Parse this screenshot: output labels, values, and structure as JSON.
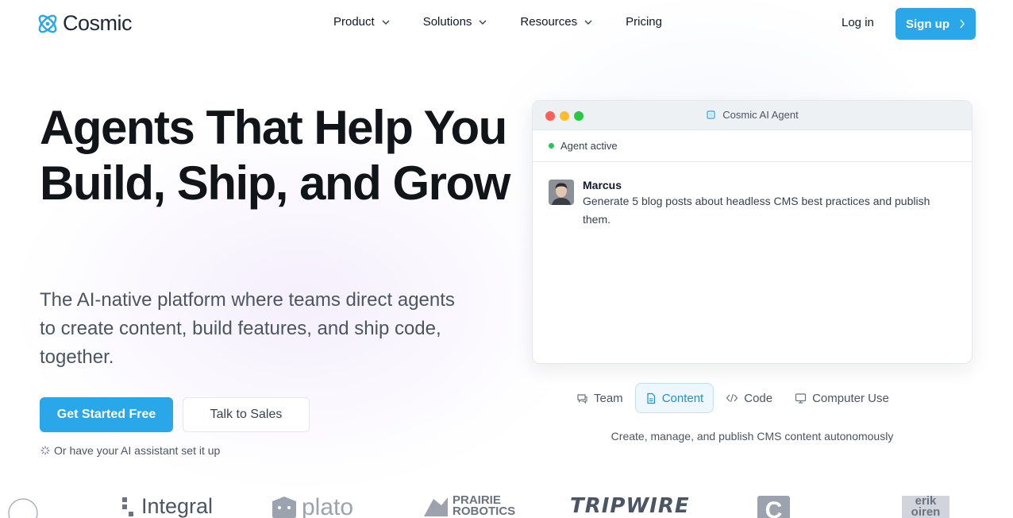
{
  "nav": {
    "logo_text": "Cosmic",
    "items": [
      {
        "label": "Product"
      },
      {
        "label": "Solutions"
      },
      {
        "label": "Resources"
      },
      {
        "label": "Pricing"
      }
    ],
    "login_label": "Log in",
    "signup_label": "Sign up"
  },
  "hero": {
    "title": "Agents That Help You Build, Ship, and Grow",
    "subtitle": "The AI-native platform where teams direct agents to create content, build features, and ship code, together.",
    "primary_cta": "Get Started Free",
    "secondary_cta": "Talk to Sales",
    "assistant_note": "Or have your AI assistant set it up"
  },
  "agent_window": {
    "title": "Cosmic AI Agent",
    "status": "Agent active",
    "message": {
      "author": "Marcus",
      "text": "Generate 5 blog posts about headless CMS best practices and publish them."
    }
  },
  "tabs": {
    "items": [
      {
        "label": "Team",
        "icon": "chat-icon"
      },
      {
        "label": "Content",
        "icon": "document-icon"
      },
      {
        "label": "Code",
        "icon": "code-icon"
      },
      {
        "label": "Computer Use",
        "icon": "monitor-icon"
      }
    ],
    "active": "Content",
    "caption": "Create, manage, and publish CMS content autonomously"
  },
  "logos": {
    "brands": [
      "Integral",
      "plato",
      "PRAIRIE ROBOTICS",
      "TRIPWIRE",
      "C",
      "erik oiren"
    ]
  },
  "colors": {
    "accent": "#2aa7e8",
    "status_green": "#22c55e"
  }
}
